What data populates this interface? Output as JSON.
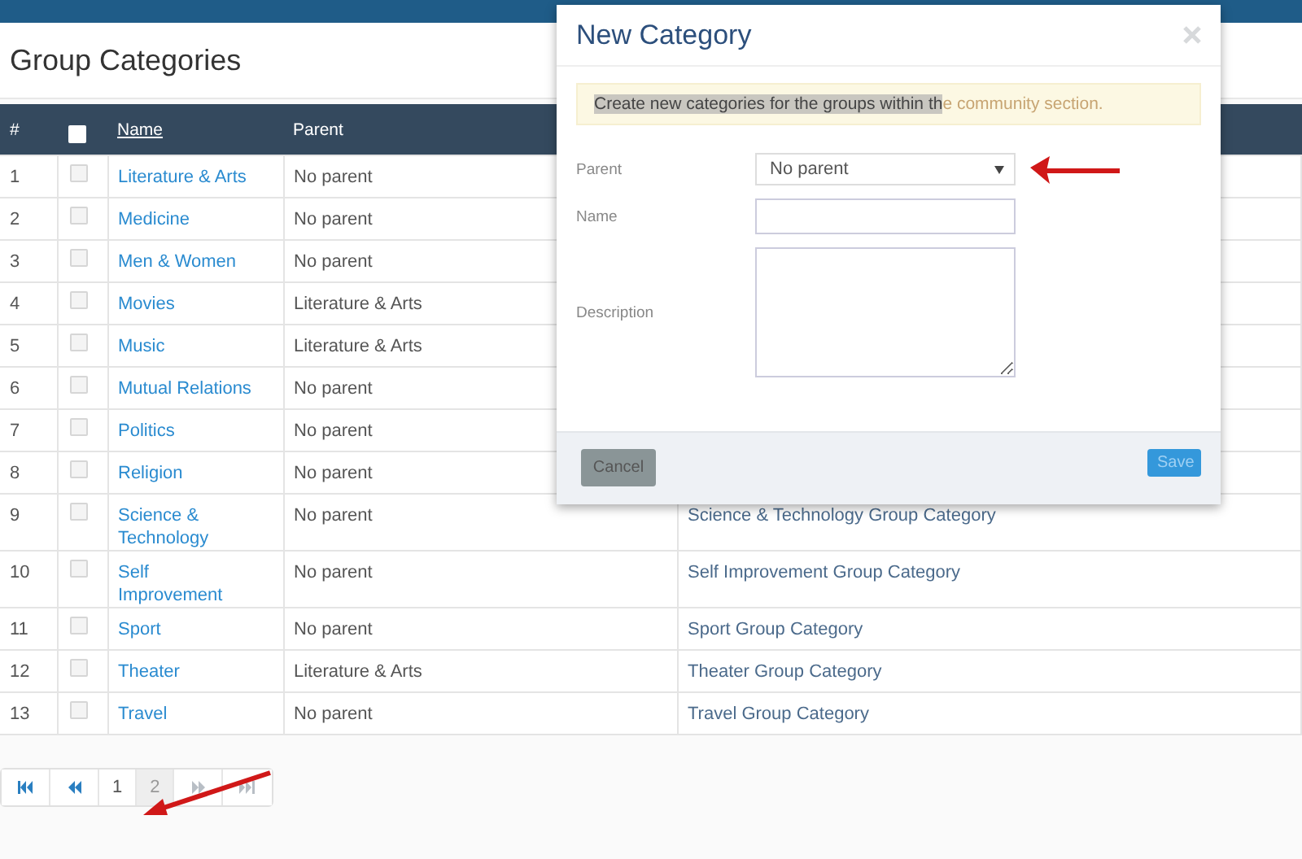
{
  "page": {
    "title": "Group Categories"
  },
  "table": {
    "columns": [
      {
        "label": "#",
        "kind": "text"
      },
      {
        "kind": "checkbox",
        "checked": false
      },
      {
        "label": "Name",
        "kind": "link"
      },
      {
        "label": "Parent",
        "kind": "text"
      }
    ],
    "rows": [
      {
        "number": "1",
        "checked": false,
        "name": "Literature & Arts",
        "parent": "No parent"
      },
      {
        "number": "2",
        "checked": false,
        "name": "Medicine",
        "parent": "No parent"
      },
      {
        "number": "3",
        "checked": false,
        "name": "Men & Women",
        "parent": "No parent"
      },
      {
        "number": "4",
        "checked": false,
        "name": "Movies",
        "parent": "Literature & Arts"
      },
      {
        "number": "5",
        "checked": false,
        "name": "Music",
        "parent": "Literature & Arts"
      },
      {
        "number": "6",
        "checked": false,
        "name": "Mutual Relations",
        "parent": "No parent"
      },
      {
        "number": "7",
        "checked": false,
        "name": "Politics",
        "parent": "No parent"
      },
      {
        "number": "8",
        "checked": false,
        "name": "Religion",
        "parent": "No parent"
      },
      {
        "number": "9",
        "checked": false,
        "name": "Science & Technology",
        "parent": "No parent",
        "description": "Science & Technology Group Category"
      },
      {
        "number": "10",
        "checked": false,
        "name": "Self Improvement",
        "parent": "No parent",
        "description": "Self Improvement Group Category"
      },
      {
        "number": "11",
        "checked": false,
        "name": "Sport",
        "parent": "No parent",
        "description": "Sport Group Category"
      },
      {
        "number": "12",
        "checked": false,
        "name": "Theater",
        "parent": "Literature & Arts",
        "description": "Theater Group Category"
      },
      {
        "number": "13",
        "checked": false,
        "name": "Travel",
        "parent": "No parent",
        "description": "Travel Group Category"
      }
    ]
  },
  "pagination": [
    {
      "kind": "first"
    },
    {
      "kind": "prev"
    },
    {
      "kind": "page",
      "label": "1",
      "selected": false
    },
    {
      "kind": "page",
      "label": "2",
      "selected": true
    },
    {
      "kind": "next"
    },
    {
      "kind": "last"
    }
  ],
  "modal": {
    "title": "New Category",
    "alert": {
      "selected_text": "Create new categories for the groups within th",
      "text": "e community section."
    },
    "fields": [
      {
        "kind": "select",
        "label": "Parent",
        "value": "No parent"
      },
      {
        "kind": "input",
        "label": "Name"
      },
      {
        "kind": "textarea",
        "label": "Description"
      }
    ],
    "buttons": [
      {
        "kind": "cancel",
        "label": "Cancel"
      },
      {
        "kind": "save",
        "label": "Save"
      }
    ]
  }
}
